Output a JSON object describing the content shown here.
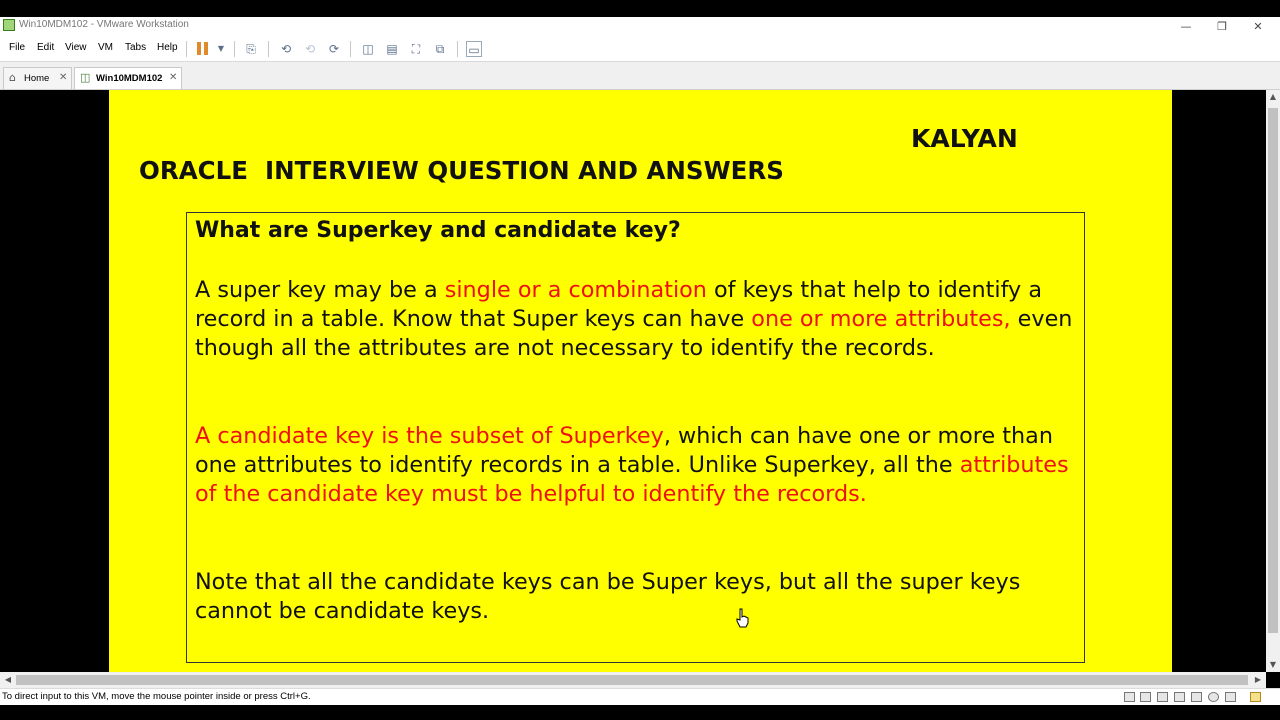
{
  "window": {
    "title": "Win10MDM102 - VMware Workstation"
  },
  "menu": [
    "File",
    "Edit",
    "View",
    "VM",
    "Tabs",
    "Help"
  ],
  "tabs": [
    {
      "label": "Home"
    },
    {
      "label": "Win10MDM102"
    }
  ],
  "slide": {
    "author": "KALYAN",
    "title": "ORACLE  INTERVIEW QUESTION AND ANSWERS",
    "question": "What are Superkey and candidate key?",
    "p1": {
      "t1": "A super key may be a ",
      "r1": "single or a combination",
      "t2": " of keys that help to identify a record in a table. Know that Super keys can have ",
      "r2": "one or more attributes,",
      "t3": " even though all the attributes are not necessary to identify the records."
    },
    "p2": {
      "r1": "A candidate key is the subset of Superkey",
      "t1": ", which can have one or more than one attributes to identify records in a table. Unlike Superkey, all the ",
      "r2": "attributes of the candidate key must be helpful to identify the records."
    },
    "p3": "Note that all the candidate keys can be Super keys, but all the super keys cannot be candidate keys."
  },
  "status": {
    "text": "To direct input to this VM, move the mouse pointer inside or press Ctrl+G."
  },
  "colors": {
    "slide_bg": "#ffff00",
    "highlight": "#ee1111"
  }
}
